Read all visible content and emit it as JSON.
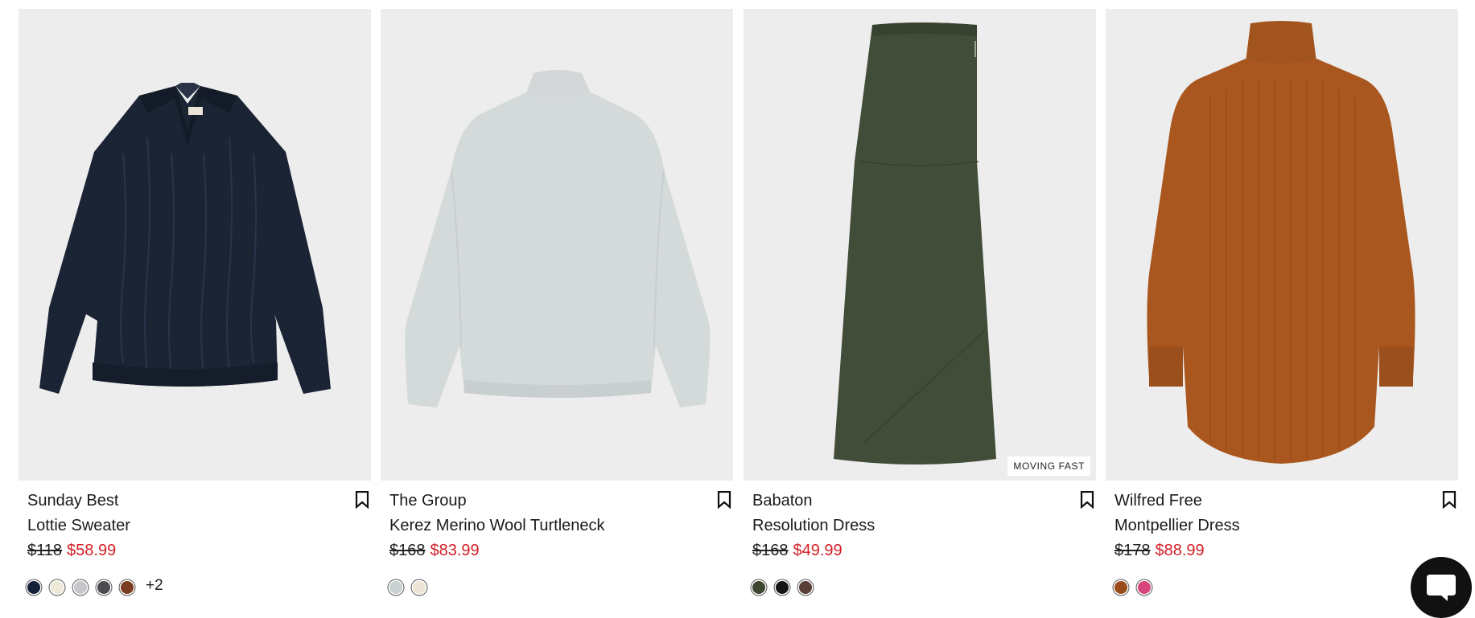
{
  "products": [
    {
      "brand": "Sunday Best",
      "name": "Lottie Sweater",
      "original_price": "$118",
      "sale_price": "$58.99",
      "badge": "",
      "swatches": [
        "#14213a",
        "#ede8d8",
        "#c4c6c9",
        "#4a4c50",
        "#7a3d22"
      ],
      "more_colors": "+2"
    },
    {
      "brand": "The Group",
      "name": "Kerez Merino Wool Turtleneck",
      "original_price": "$168",
      "sale_price": "$83.99",
      "badge": "",
      "swatches": [
        "#c8d0d2",
        "#ede6d6"
      ],
      "more_colors": ""
    },
    {
      "brand": "Babaton",
      "name": "Resolution Dress",
      "original_price": "$168",
      "sale_price": "$49.99",
      "badge": "MOVING FAST",
      "swatches": [
        "#3c4631",
        "#151515",
        "#5a3d37"
      ],
      "more_colors": ""
    },
    {
      "brand": "Wilfred Free",
      "name": "Montpellier Dress",
      "original_price": "$178",
      "sale_price": "$88.99",
      "badge": "",
      "swatches": [
        "#9a4c1c",
        "#d6467c"
      ],
      "more_colors": ""
    }
  ],
  "colors": {
    "sale_price": "#d21f26",
    "image_background": "#ededed",
    "chat_button": "#111111"
  },
  "icons": {
    "bookmark": "bookmark-icon",
    "chat": "chat-icon"
  }
}
